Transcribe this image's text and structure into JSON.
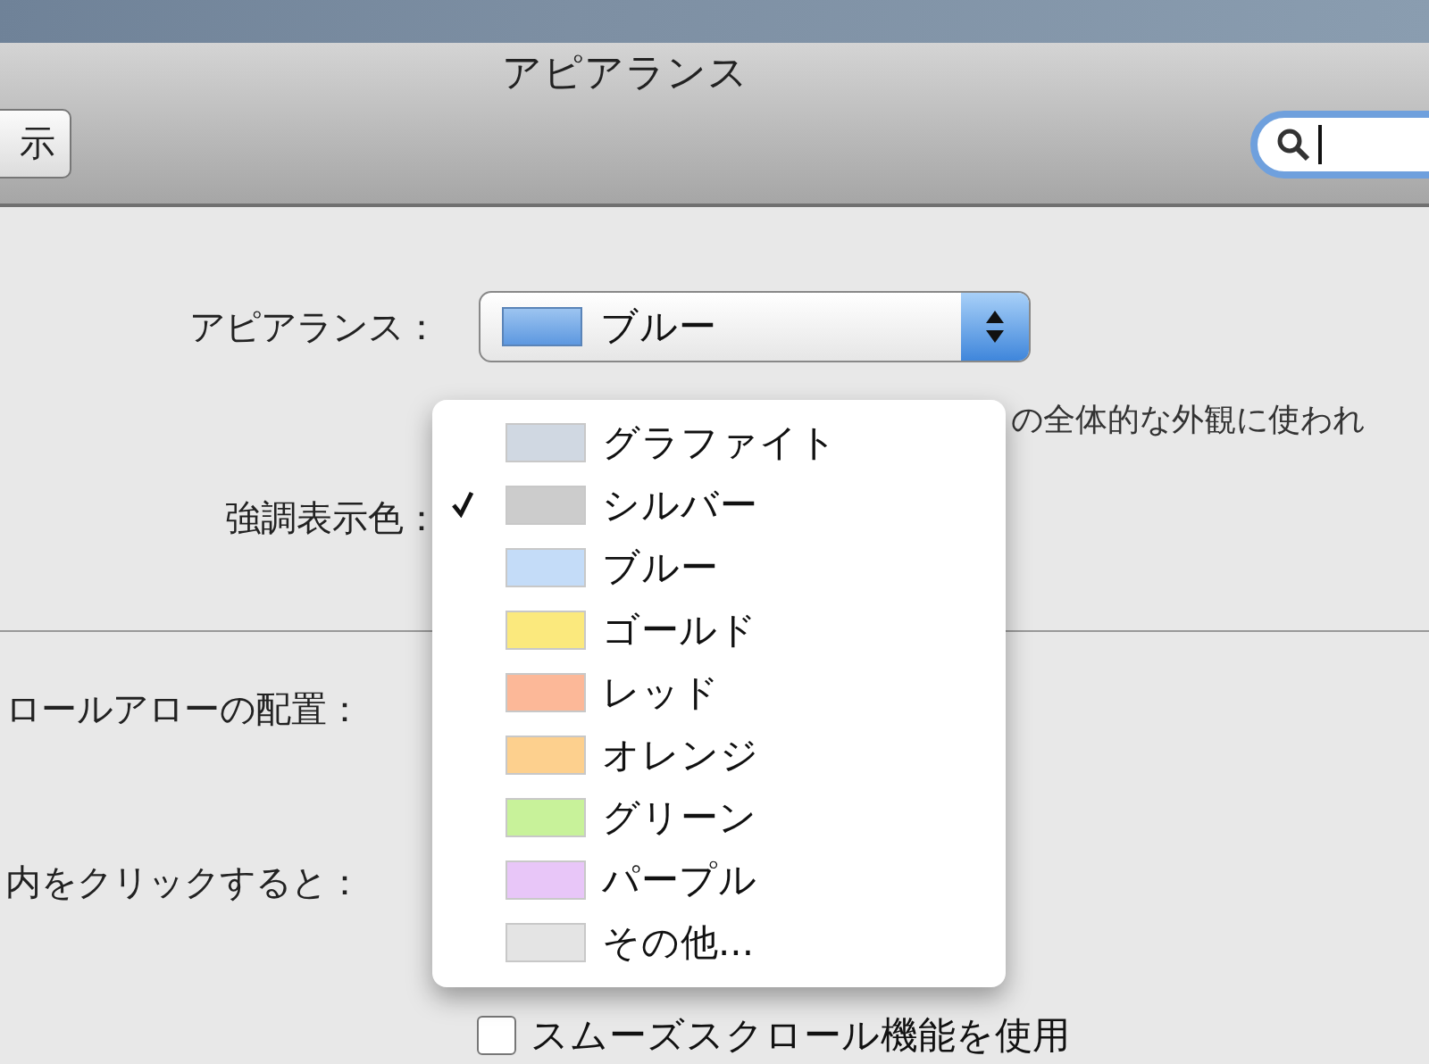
{
  "window": {
    "title": "アピアランス"
  },
  "toolbar": {
    "button": "示",
    "search": {
      "focused": true
    }
  },
  "appearance": {
    "label": "アピアランス：",
    "value": "ブルー"
  },
  "appearance_description": "の全体的な外観に使われ",
  "highlight": {
    "label": "強調表示色：",
    "menu": [
      {
        "label": "グラファイト",
        "color": "#d0d8e2",
        "checked": false
      },
      {
        "label": "シルバー",
        "color": "#cccccc",
        "checked": true
      },
      {
        "label": "ブルー",
        "color": "#c4dcf8",
        "checked": false
      },
      {
        "label": "ゴールド",
        "color": "#fbe97d",
        "checked": false
      },
      {
        "label": "レッド",
        "color": "#fcb898",
        "checked": false
      },
      {
        "label": "オレンジ",
        "color": "#fdd08e",
        "checked": false
      },
      {
        "label": "グリーン",
        "color": "#c8f29a",
        "checked": false
      },
      {
        "label": "パープル",
        "color": "#e8c6f8",
        "checked": false
      },
      {
        "label": "その他...",
        "color": "#e4e4e4",
        "checked": false
      }
    ]
  },
  "scroll_arrows": {
    "label": "ロールアローの配置："
  },
  "click_scrollbar": {
    "label": "内をクリックすると："
  },
  "smooth_scroll": {
    "label": "スムーズスクロール機能を使用",
    "checked": false
  }
}
